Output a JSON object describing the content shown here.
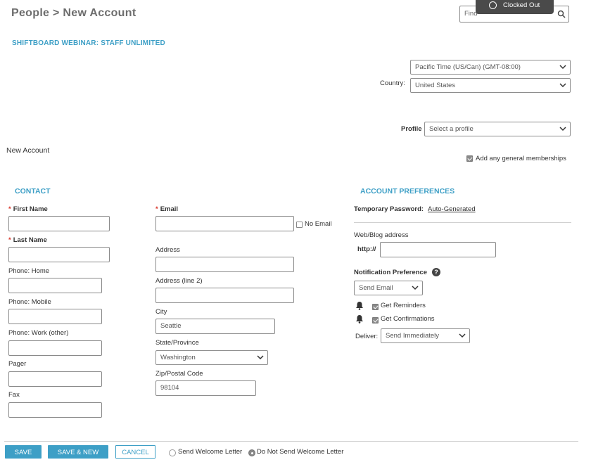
{
  "header": {
    "breadcrumb": "People > New Account",
    "search_placeholder": "Find",
    "clock_status": "Clocked Out"
  },
  "org_name": "SHIFTBOARD WEBINAR: STAFF UNLIMITED",
  "location": {
    "timezone": "Pacific Time (US/Can) (GMT-08:00)",
    "country_label": "Country:",
    "country": "United States"
  },
  "profile": {
    "label": "Profile",
    "placeholder": "Select a profile"
  },
  "page_subtitle": "New Account",
  "general_memberships": {
    "label": "Add any general memberships",
    "checked": true
  },
  "contact": {
    "heading": "CONTACT",
    "first_name": "First Name",
    "last_name": "Last Name",
    "phone_home": "Phone: Home",
    "phone_mobile": "Phone: Mobile",
    "phone_work": "Phone: Work (other)",
    "pager": "Pager",
    "fax": "Fax",
    "email": "Email",
    "no_email": "No Email",
    "address": "Address",
    "address2": "Address (line 2)",
    "city": "City",
    "city_value": "Seattle",
    "state": "State/Province",
    "state_value": "Washington",
    "zip": "Zip/Postal Code",
    "zip_value": "98104"
  },
  "preferences": {
    "heading": "ACCOUNT PREFERENCES",
    "temp_password_label": "Temporary Password:",
    "temp_password_value": "Auto-Generated",
    "web_label": "Web/Blog address",
    "web_prefix": "http://",
    "notification_label": "Notification Preference",
    "notification_value": "Send Email",
    "reminders_label": "Get Reminders",
    "confirmations_label": "Get Confirmations",
    "deliver_label": "Deliver:",
    "deliver_value": "Send Immediately"
  },
  "footer": {
    "save": "SAVE",
    "save_new": "SAVE & NEW",
    "cancel": "CANCEL",
    "send_welcome": "Send Welcome Letter",
    "no_welcome": "Do Not Send Welcome Letter",
    "selected_option": "Do Not Send Welcome Letter"
  },
  "colors": {
    "accent": "#3d9fc6",
    "required": "#d9362b",
    "title": "#6d6d6d"
  }
}
